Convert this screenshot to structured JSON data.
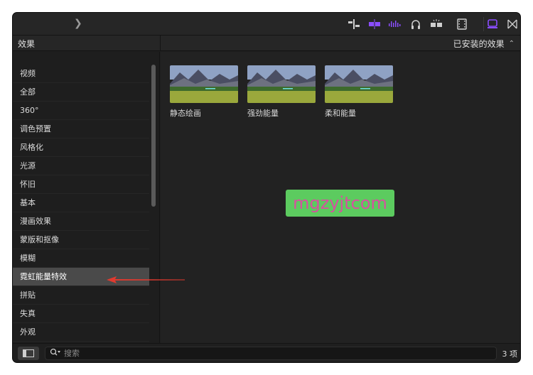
{
  "toolbar": {
    "icons": [
      "chevron-right-icon",
      "timeline-align-icon",
      "audio-waveform-purple-icon",
      "audio-bars-purple-icon",
      "headphones-icon",
      "sparkle-clip-icon",
      "filmstrip-icon",
      "effects-browser-icon",
      "transitions-icon"
    ],
    "accent_color": "#8a4dff"
  },
  "header": {
    "panel_title": "效果",
    "filter_label": "已安装的效果",
    "filter_icon": "up-down-arrows-icon"
  },
  "sidebar": {
    "items": [
      {
        "label": "视频"
      },
      {
        "label": "全部"
      },
      {
        "label": "360°"
      },
      {
        "label": "调色预置"
      },
      {
        "label": "风格化"
      },
      {
        "label": "光源"
      },
      {
        "label": "怀旧"
      },
      {
        "label": "基本"
      },
      {
        "label": "漫画效果"
      },
      {
        "label": "蒙版和抠像"
      },
      {
        "label": "模糊"
      },
      {
        "label": "霓虹能量特效"
      },
      {
        "label": "拼贴"
      },
      {
        "label": "失真"
      },
      {
        "label": "外观"
      }
    ],
    "selected_index": 11
  },
  "main": {
    "effects": [
      {
        "name": "静态绘画"
      },
      {
        "name": "强劲能量"
      },
      {
        "name": "柔和能量"
      }
    ],
    "watermark": "mgzyjtcom"
  },
  "bottom": {
    "search_placeholder": "搜索",
    "search_icon": "magnifier-dropdown-icon",
    "count_label": "3 项"
  },
  "annotation": {
    "arrow_color": "#e03a2f"
  }
}
